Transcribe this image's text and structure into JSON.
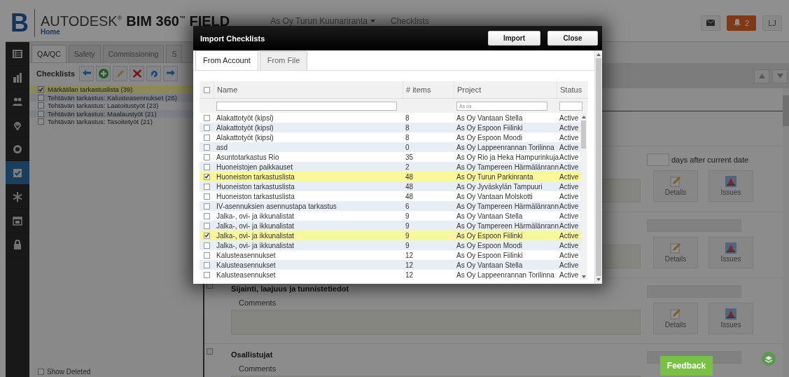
{
  "header": {
    "logo": "B",
    "brand": "AUTODESK$^{®}$",
    "product": "BIM 360$^{™}$ FIELD",
    "home": "Home",
    "breadcrumbs": [
      {
        "label": "As Oy Turun Kuunariranta",
        "dropdown": true
      },
      {
        "label": "Checklists",
        "dropdown": false
      }
    ],
    "notifications": "2",
    "user": "LJ"
  },
  "sidebar": {
    "items": [
      {
        "selected": false
      },
      {
        "selected": false
      },
      {
        "selected": false
      },
      {
        "selected": false
      },
      {
        "selected": false
      },
      {
        "selected": true
      },
      {
        "selected": false
      },
      {
        "selected": false
      },
      {
        "selected": false
      }
    ]
  },
  "tabs": [
    {
      "label": "QA/QC",
      "selected": true
    },
    {
      "label": "Safety",
      "selected": false
    },
    {
      "label": "Commissioning",
      "selected": false
    },
    {
      "label": "S",
      "selected": false
    }
  ],
  "checklists": {
    "title": "Checklists",
    "items": [
      {
        "label": "Märkätilan tarkastuslista (39)",
        "checked": true
      },
      {
        "label": "Tehtävän tarkastus: Kalusteasennukset (26)",
        "checked": false
      },
      {
        "label": "Tehtävän tarkastus: Laatoitustyöt (23)",
        "checked": false
      },
      {
        "label": "Tehtävän tarkastus: Maalaustyöt (21)",
        "checked": false
      },
      {
        "label": "Tehtävän tarkastus: Tasoitetyöt (21)",
        "checked": false
      }
    ],
    "show_deleted": {
      "label": "Show Deleted",
      "checked": false
    }
  },
  "content": {
    "rows": [
      {
        "days_label": "days after current date",
        "details": "Details",
        "issues": "Issues"
      },
      {
        "details": "Details",
        "issues": "Issues"
      },
      {
        "checked": false,
        "title": "Sijainti, laajuus ja tunnistetiedot",
        "comments_label": "Comments",
        "details": "Details",
        "issues": "Issues"
      },
      {
        "checked": false,
        "title": "Osallistujat",
        "comments_label": "Comments"
      }
    ]
  },
  "dialog": {
    "title": "Import Checklists",
    "buttons": [
      "Import",
      "Close"
    ],
    "tabs": [
      {
        "label": "From Account",
        "selected": true
      },
      {
        "label": "From File",
        "selected": false
      }
    ],
    "table": {
      "header_checked": false,
      "columns": [
        "Name",
        "# items",
        "Project",
        "Status"
      ],
      "filters": {
        "project": "As oy"
      },
      "rows": [
        {
          "name": "Alakattotyöt (kipsi)",
          "items": "8",
          "project": "As Oy Vantaan Stella",
          "status": "Active",
          "checked": false
        },
        {
          "name": "Alakattotyöt (kipsi)",
          "items": "8",
          "project": "As Oy Espoon Fiilinki",
          "status": "Active",
          "checked": false
        },
        {
          "name": "Alakattotyöt (kipsi)",
          "items": "8",
          "project": "As Oy Espoon Moodi",
          "status": "Active",
          "checked": false
        },
        {
          "name": "asd",
          "items": "0",
          "project": "As Oy Lappeenrannan Torilinna",
          "status": "Active",
          "checked": false
        },
        {
          "name": "Asuntotarkastus Rio",
          "items": "35",
          "project": "As Oy Rio ja Heka Hampurinkuja",
          "status": "Active",
          "checked": false
        },
        {
          "name": "Huoneistojen paikkauset",
          "items": "2",
          "project": "As Oy Tampereen Härmälänrann",
          "status": "Active",
          "checked": false
        },
        {
          "name": "Huoneiston tarkastuslista",
          "items": "48",
          "project": "As Oy Turun Parkinranta",
          "status": "Active",
          "checked": true
        },
        {
          "name": "Huoneiston tarkastuslista",
          "items": "48",
          "project": "As Oy Jyväskylän Tampuuri",
          "status": "Active",
          "checked": false
        },
        {
          "name": "Huoneiston tarkastuslista",
          "items": "48",
          "project": "As Oy Vantaan Molskotti",
          "status": "Active",
          "checked": false
        },
        {
          "name": "IV-asennuksien asennustapa tarkastus",
          "items": "6",
          "project": "As Oy Tampereen Härmälänrann",
          "status": "Active",
          "checked": false
        },
        {
          "name": "Jalka-, ovi- ja ikkunalistat",
          "items": "9",
          "project": "As Oy Vantaan Stella",
          "status": "Active",
          "checked": false
        },
        {
          "name": "Jalka-, ovi- ja ikkunalistat",
          "items": "9",
          "project": "As Oy Tampereen Härmälänrann",
          "status": "Active",
          "checked": false
        },
        {
          "name": "Jalka-, ovi- ja ikkunalistat",
          "items": "9",
          "project": "As Oy Espoon Fiilinki",
          "status": "Active",
          "checked": true
        },
        {
          "name": "Jalka-, ovi- ja ikkunalistat",
          "items": "9",
          "project": "As Oy Espoon Moodi",
          "status": "Active",
          "checked": false
        },
        {
          "name": "Kalusteasennukset",
          "items": "12",
          "project": "As Oy Espoon Fiilinki",
          "status": "Active",
          "checked": false
        },
        {
          "name": "Kalusteasennukset",
          "items": "12",
          "project": "As Oy Vantaan Stella",
          "status": "Active",
          "checked": false
        },
        {
          "name": "Kalusteasennukset",
          "items": "12",
          "project": "As Oy Lappeenrannan Torilinna",
          "status": "Active",
          "checked": false
        }
      ]
    }
  },
  "feedback": "Feedback"
}
